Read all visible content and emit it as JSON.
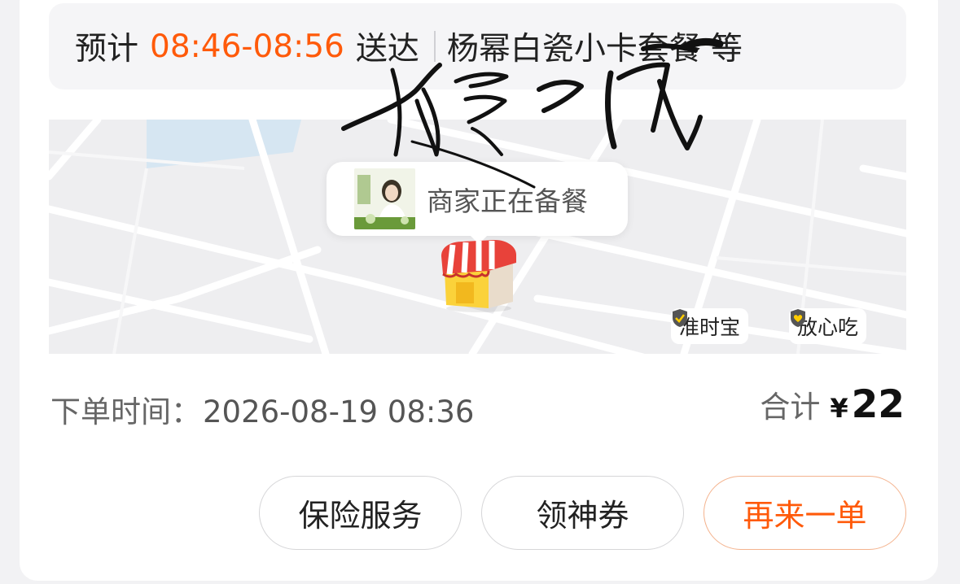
{
  "eta": {
    "prefix": "预计",
    "time_range": "08:46-08:56",
    "suffix": "送达",
    "items": "杨幂白瓷小卡套餐",
    "more": "等"
  },
  "map": {
    "status_text": "商家正在备餐",
    "badges": [
      {
        "label": "准时宝",
        "icon": "shield-check-icon",
        "color": "#555555"
      },
      {
        "label": "放心吃",
        "icon": "shield-heart-icon",
        "color": "#ffcc00"
      }
    ]
  },
  "order": {
    "time_label": "下单时间：",
    "time_value": "2026-08-19 08:36",
    "total_label": "合计",
    "currency": "¥",
    "total_amount": "22"
  },
  "actions": {
    "insurance": "保险服务",
    "coupon": "领神券",
    "reorder": "再来一单"
  },
  "colors": {
    "accent": "#ff5a0a",
    "badge_yellow": "#ffcc00"
  }
}
